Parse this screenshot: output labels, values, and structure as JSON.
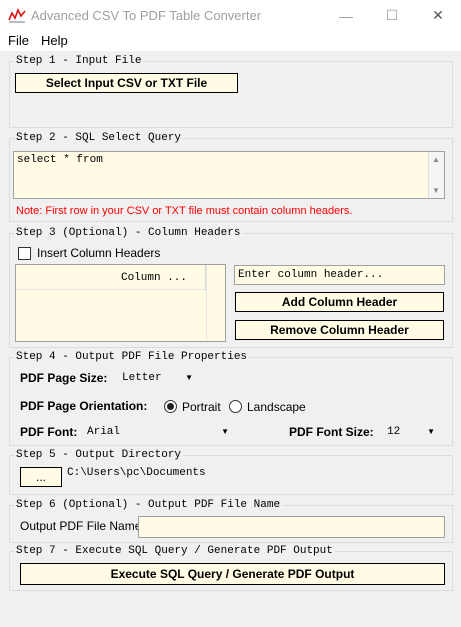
{
  "window": {
    "title": "Advanced CSV To PDF Table Converter",
    "minimize_glyph": "—",
    "maximize_glyph": "☐",
    "close_glyph": "✕"
  },
  "menu": {
    "file": "File",
    "help": "Help"
  },
  "step1": {
    "label": "Step 1 - Input File",
    "select_button": "Select Input CSV or TXT File"
  },
  "step2": {
    "label": "Step 2 - SQL Select Query",
    "query": "select * from",
    "note": "Note: First row in your CSV or TXT file must contain column headers.",
    "note_color": "#ff0000"
  },
  "step3": {
    "label": "Step 3 (Optional) - Column Headers",
    "insert_checkbox_label": "Insert Column Headers",
    "list_column_header": "Column ...",
    "header_placeholder": "Enter column header...",
    "add_button": "Add Column Header",
    "remove_button": "Remove Column Header"
  },
  "step4": {
    "label": "Step 4 - Output PDF File Properties",
    "page_size_label": "PDF Page Size:",
    "page_size_value": "Letter",
    "orientation_label": "PDF Page Orientation:",
    "portrait": "Portrait",
    "landscape": "Landscape",
    "font_label": "PDF Font:",
    "font_value": "Arial",
    "font_size_label": "PDF Font Size:",
    "font_size_value": "12"
  },
  "step5": {
    "label": "Step 5 - Output Directory",
    "browse_button": "...",
    "directory": "C:\\Users\\pc\\Documents"
  },
  "step6": {
    "label": "Step 6 (Optional) - Output PDF File Name",
    "field_label": "Output PDF File Name:"
  },
  "step7": {
    "label": "Step 7 - Execute SQL Query / Generate PDF Output",
    "execute_button": "Execute SQL Query / Generate PDF Output"
  }
}
